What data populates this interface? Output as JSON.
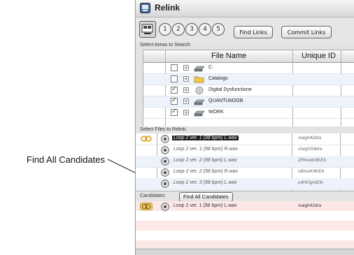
{
  "callout": {
    "label": "Find All Candidates"
  },
  "window": {
    "title": "Relink"
  },
  "toolbar": {
    "numbers": [
      "1",
      "2",
      "3",
      "4",
      "5"
    ],
    "find_links": "Find Links",
    "commit_links": "Commit Links"
  },
  "areas": {
    "section_label": "Select Areas to Search:",
    "columns": [
      "File Name",
      "Unique ID"
    ],
    "rows": [
      {
        "label": "C:",
        "checked": false,
        "icon": "drive-icon"
      },
      {
        "label": "Catalogs",
        "checked": false,
        "icon": "folder-icon"
      },
      {
        "label": "Digital Dysfunctione",
        "checked": true,
        "icon": "cd-icon"
      },
      {
        "label": "QUANTUM2GB",
        "checked": true,
        "icon": "drive-icon"
      },
      {
        "label": "WORK",
        "checked": true,
        "icon": "drive-icon"
      }
    ]
  },
  "files": {
    "section_label": "Select Files to Relink:",
    "rows": [
      {
        "name": "Loop 2  ver. 1 (98 bpm) L.wav",
        "id": "Aaigh42dra",
        "selected": true,
        "linked": true
      },
      {
        "name": "Loop 2  ver. 1 (98 bpm) R.wav",
        "id": "UuighS4dra",
        "selected": false,
        "linked": false
      },
      {
        "name": "Loop 2  ver. 2 (98 bpm) L.wav",
        "id": "ZRhreW3KEb",
        "selected": false,
        "linked": false
      },
      {
        "name": "Loop 2  ver. 2 (98 bpm) R.wav",
        "id": "vBhreK9KEb",
        "selected": false,
        "linked": false
      },
      {
        "name": "Loop 2  ver. 3 (98 bpm) L.wav",
        "id": "u4HOgntEfe",
        "selected": false,
        "linked": false
      }
    ]
  },
  "candidates": {
    "section_label": "Candidates:",
    "find_all_button": "Find All Candidates",
    "rows": [
      {
        "name": "Loop 2  ver. 1 (98 bpm) L.wav",
        "id": "Aaigh42dra"
      }
    ]
  },
  "colors": {
    "link_icon": "#e0a020",
    "selection": "#1c1c1c",
    "candidate_row": "#fde8e8"
  }
}
